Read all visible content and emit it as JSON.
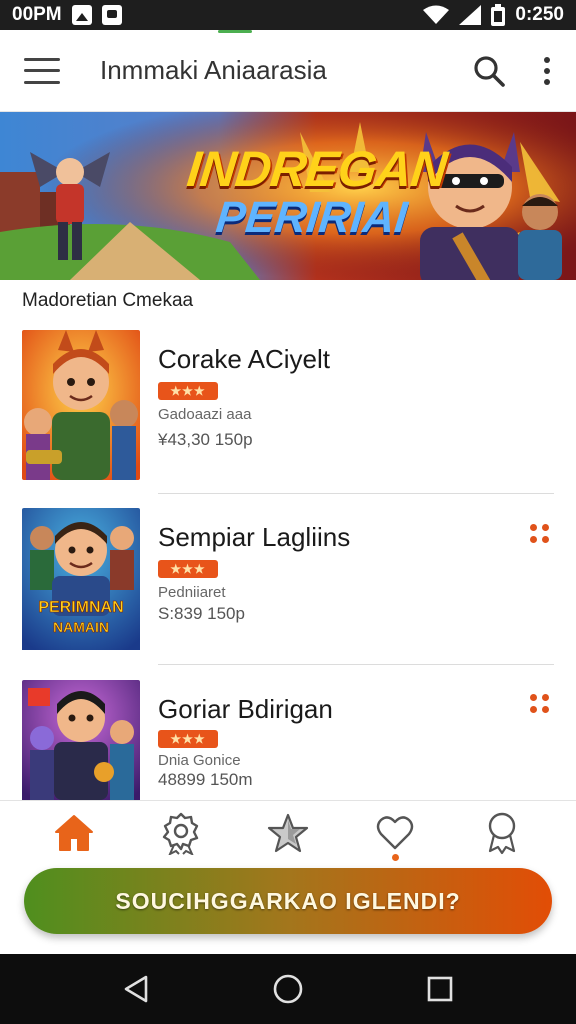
{
  "status_bar": {
    "time_left": "00PM",
    "time_right": "0:250",
    "icons_left": [
      "image-notification-icon",
      "message-notification-icon"
    ],
    "icons_right": [
      "wifi-icon",
      "signal-icon",
      "battery-icon"
    ]
  },
  "app_bar": {
    "title": "Inmmaki Aniaarasia",
    "icons": [
      "hamburger-menu-icon",
      "search-icon",
      "more-vert-icon"
    ],
    "accent_color": "#4caf50"
  },
  "banner": {
    "line1": "INDREGAN",
    "line2": "PERIRIAI"
  },
  "section": {
    "title": "Madoretian Cmekaa"
  },
  "items": [
    {
      "title": "Corake ACiyelt",
      "badge": "",
      "subtitle": "Gadoaazi aaa",
      "meta": "¥43,30 150p",
      "has_more": false
    },
    {
      "title": "Sempiar Lagliins",
      "badge": "",
      "subtitle": "Pedniiaret",
      "meta": "S:839 150p",
      "thumb_text1": "PERIMNAN",
      "thumb_text2": "NAMAIN",
      "has_more": true
    },
    {
      "title": "Goriar Bdirigan",
      "badge": "",
      "subtitle": "Dnia Gonice",
      "meta": "48899 150m",
      "has_more": true
    }
  ],
  "bottom_nav": {
    "items": [
      "home-icon",
      "settings-badge-icon",
      "star-icon",
      "heart-icon",
      "award-icon"
    ],
    "active_color": "#e8641a"
  },
  "cta": {
    "label": "SOUCIHGGARKAO IGLENDI?",
    "gradient": [
      "#4f8f1e",
      "#a3761c",
      "#e24d06"
    ]
  },
  "system_nav": {
    "icons": [
      "back-icon",
      "home-circle-icon",
      "recents-icon"
    ]
  }
}
